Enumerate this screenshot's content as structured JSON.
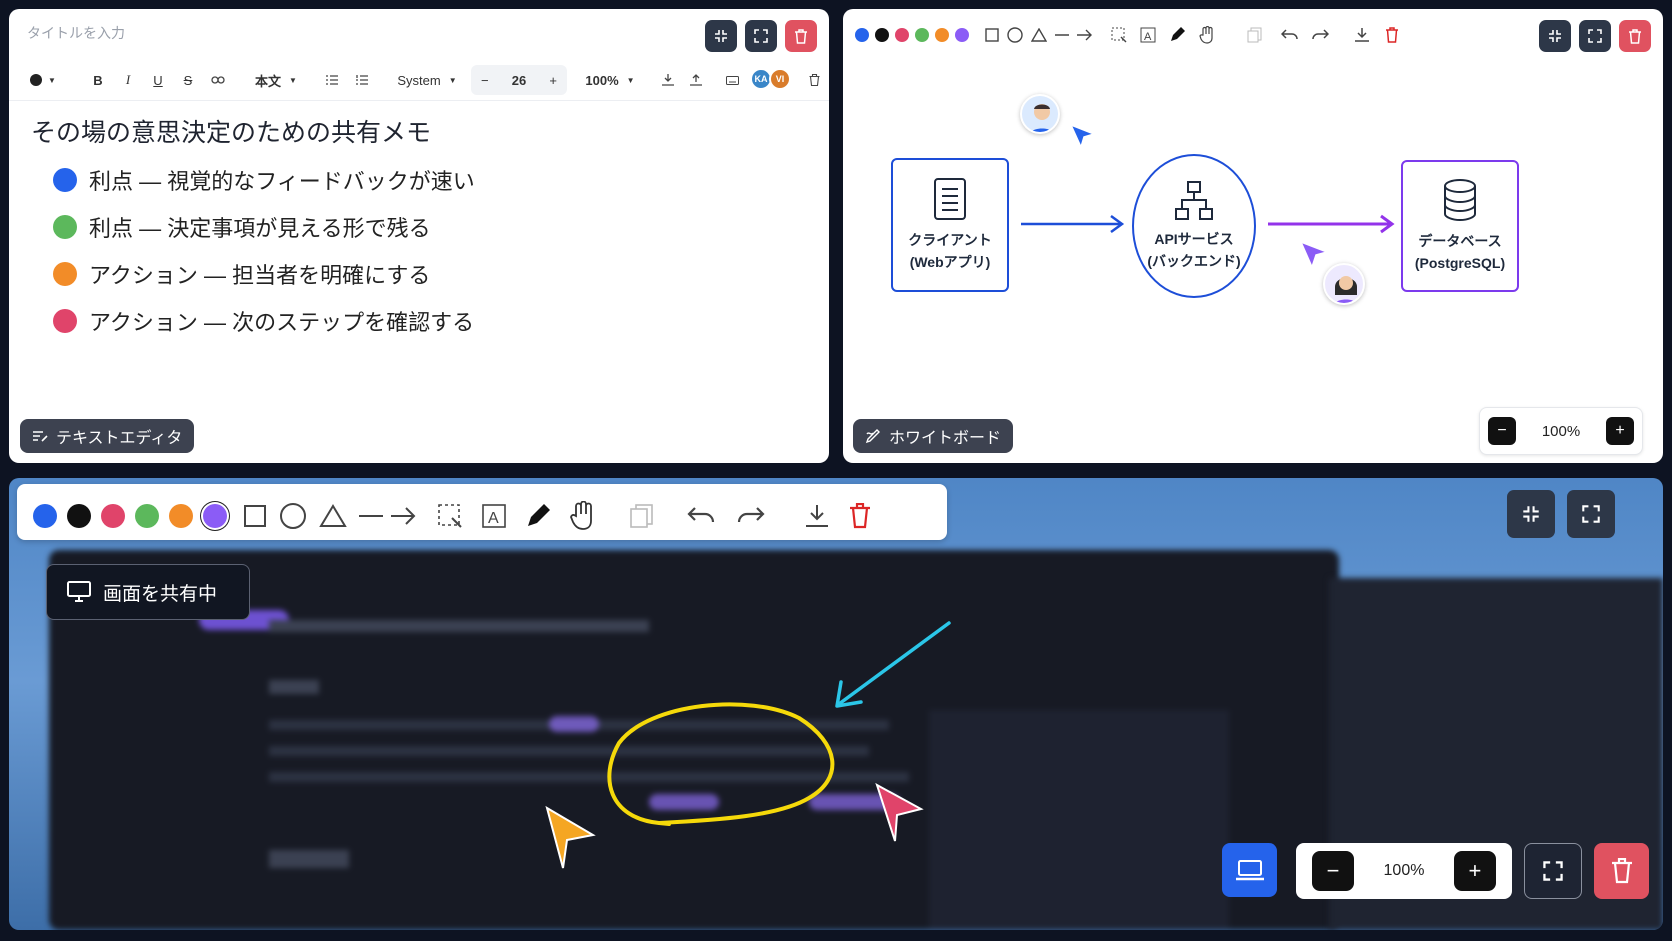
{
  "editor": {
    "title_placeholder": "タイトルを入力",
    "heading": "その場の意思決定のための共有メモ",
    "toolbar": {
      "bold": "B",
      "italic": "I",
      "underline": "U",
      "strike": "S",
      "style_select": "本文",
      "font_select": "System",
      "font_size": "26",
      "minus": "−",
      "plus": "+",
      "zoom": "100%"
    },
    "avatars": [
      "KA",
      "VI"
    ],
    "bullets": [
      {
        "text": "利点 — 視覚的なフィードバックが速い",
        "color": "#2563eb"
      },
      {
        "text": "利点 — 決定事項が見える形で残る",
        "color": "#5cb85c"
      },
      {
        "text": "アクション — 担当者を明確にする",
        "color": "#f28c28"
      },
      {
        "text": "アクション — 次のステップを確認する",
        "color": "#e0446a"
      }
    ],
    "label": "テキストエディタ"
  },
  "whiteboard": {
    "colors": [
      "#2563eb",
      "#111111",
      "#e0446a",
      "#5cb85c",
      "#f28c28",
      "#8b5cf6"
    ],
    "nodes": [
      {
        "line1": "クライアント",
        "line2": "(Webアプリ)",
        "icon": "document-icon"
      },
      {
        "line1": "APIサービス",
        "line2": "(バックエンド)",
        "icon": "hierarchy-icon"
      },
      {
        "line1": "データベース",
        "line2": "(PostgreSQL)",
        "icon": "database-icon"
      }
    ],
    "zoom": "100%",
    "zoom_minus": "−",
    "zoom_plus": "+",
    "label": "ホワイトボード"
  },
  "share": {
    "colors": [
      "#2563eb",
      "#111111",
      "#e0446a",
      "#5cb85c",
      "#f28c28",
      "#8b5cf6"
    ],
    "status": "画面を共有中",
    "zoom": "100%",
    "zoom_minus": "−",
    "zoom_plus": "+",
    "annotation_colors": {
      "circle": "#f5d90a",
      "arrow": "#2bc6e8",
      "cursor1": "#f5a623",
      "cursor2": "#e0446a"
    }
  }
}
